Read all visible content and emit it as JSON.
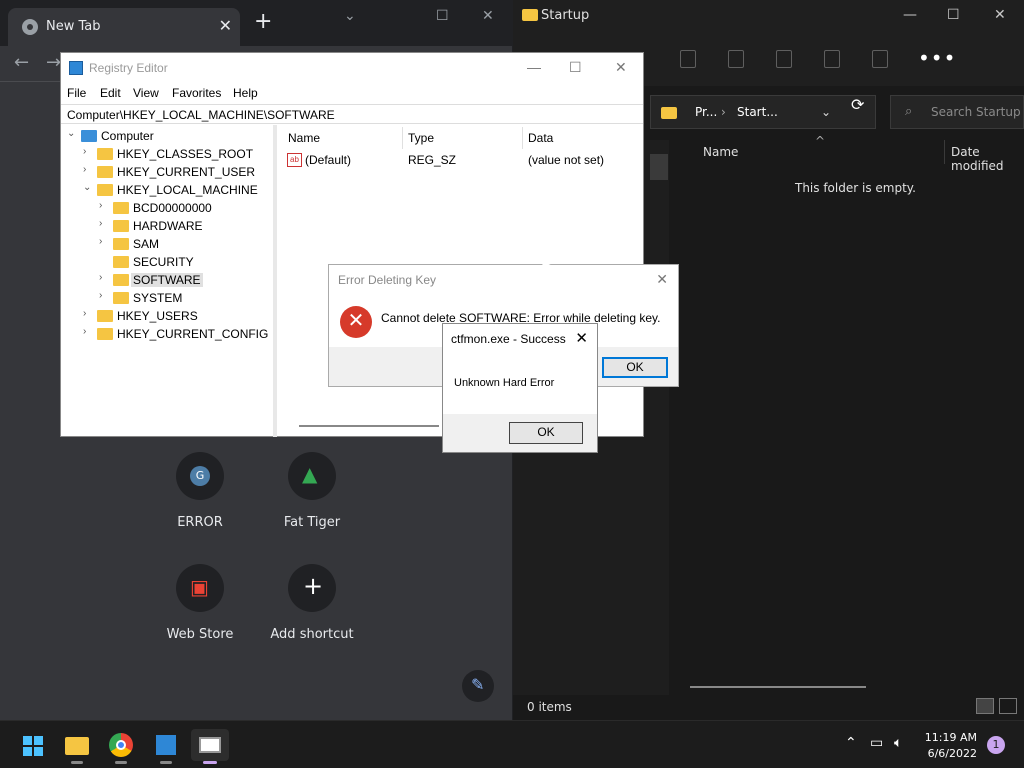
{
  "chrome": {
    "tab_title": "New Tab",
    "tab_close": "✕",
    "new_tab": "+",
    "shortcuts": [
      {
        "label": "ERROR",
        "icon": "G"
      },
      {
        "label": "Fat Tiger",
        "icon": "▲"
      },
      {
        "label": "Web Store",
        "icon": "▣"
      },
      {
        "label": "Add shortcut",
        "icon": "+"
      }
    ]
  },
  "explorer": {
    "title": "Startup",
    "breadcrumb": [
      "Pr...",
      "Start..."
    ],
    "search_placeholder": "Search Startup",
    "columns": [
      "Name",
      "Date modified"
    ],
    "empty_message": "This folder is empty.",
    "status": "0 items"
  },
  "regedit": {
    "title": "Registry Editor",
    "menu": [
      "File",
      "Edit",
      "View",
      "Favorites",
      "Help"
    ],
    "path": "Computer\\HKEY_LOCAL_MACHINE\\SOFTWARE",
    "tree": [
      {
        "label": "Computer",
        "level": 0,
        "expanded": true
      },
      {
        "label": "HKEY_CLASSES_ROOT",
        "level": 1
      },
      {
        "label": "HKEY_CURRENT_USER",
        "level": 1
      },
      {
        "label": "HKEY_LOCAL_MACHINE",
        "level": 1,
        "expanded": true
      },
      {
        "label": "BCD00000000",
        "level": 2
      },
      {
        "label": "HARDWARE",
        "level": 2
      },
      {
        "label": "SAM",
        "level": 2
      },
      {
        "label": "SECURITY",
        "level": 2
      },
      {
        "label": "SOFTWARE",
        "level": 2,
        "selected": true
      },
      {
        "label": "SYSTEM",
        "level": 2
      },
      {
        "label": "HKEY_USERS",
        "level": 1
      },
      {
        "label": "HKEY_CURRENT_CONFIG",
        "level": 1
      }
    ],
    "list_columns": [
      "Name",
      "Type",
      "Data"
    ],
    "values": [
      {
        "name": "(Default)",
        "type": "REG_SZ",
        "data": "(value not set)"
      }
    ]
  },
  "error_dialog": {
    "title": "Error Deleting Key",
    "message": "Cannot delete SOFTWARE:  Error while deleting key.",
    "ok": "OK"
  },
  "ctfmon_dialog": {
    "title": "ctfmon.exe - Success",
    "message": "Unknown Hard Error",
    "ok": "OK"
  },
  "taskbar": {
    "time": "11:19 AM",
    "date": "6/6/2022",
    "notification_count": "1"
  }
}
